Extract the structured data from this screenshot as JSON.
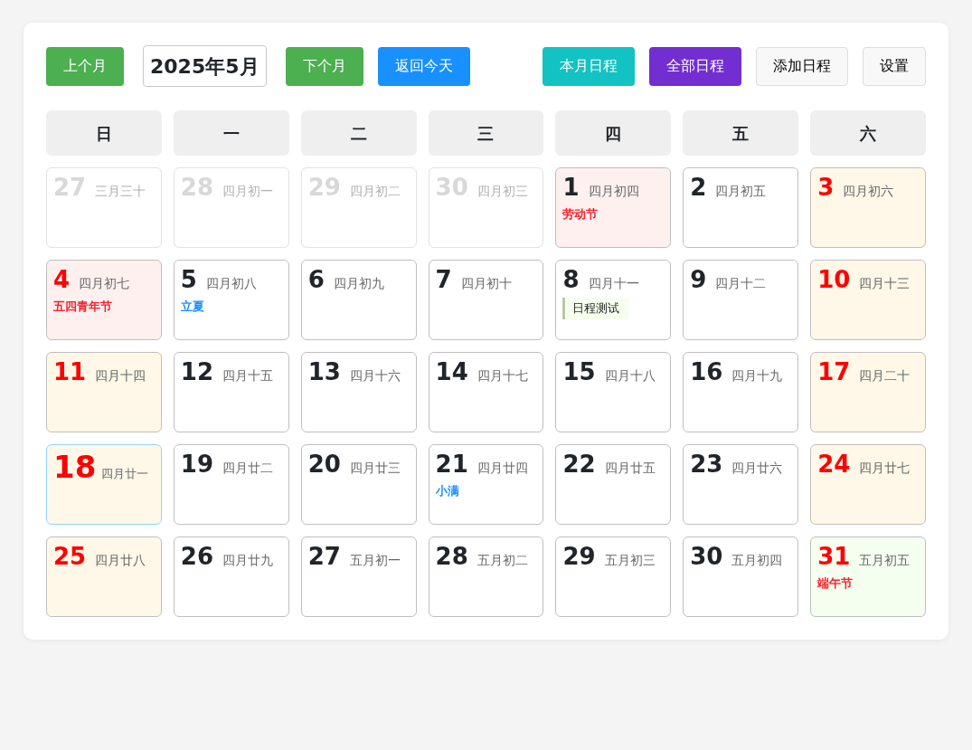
{
  "toolbar": {
    "left": [
      {
        "kind": "button",
        "label": "上个月",
        "color": "#4caf50"
      },
      {
        "kind": "title",
        "label": "2025年5月"
      },
      {
        "kind": "button",
        "label": "下个月",
        "color": "#4caf50"
      },
      {
        "kind": "button",
        "label": "返回今天",
        "color": "#1890ff"
      }
    ],
    "right": [
      {
        "kind": "button",
        "label": "本月日程",
        "color": "#13c2c2"
      },
      {
        "kind": "button",
        "label": "全部日程",
        "color": "#722ed1"
      },
      {
        "kind": "button",
        "label": "添加日程",
        "color": "#f8f8f8"
      },
      {
        "kind": "button",
        "label": "设置",
        "color": "#f8f8f8"
      }
    ]
  },
  "weekdays": [
    "日",
    "一",
    "二",
    "三",
    "四",
    "五",
    "六"
  ],
  "days": [
    {
      "day": "27",
      "lunar": "三月三十",
      "kind": "outside",
      "today": false
    },
    {
      "day": "28",
      "lunar": "四月初一",
      "kind": "outside",
      "today": false
    },
    {
      "day": "29",
      "lunar": "四月初二",
      "kind": "outside",
      "today": false
    },
    {
      "day": "30",
      "lunar": "四月初三",
      "kind": "outside",
      "today": false
    },
    {
      "day": "1",
      "lunar": "四月初四",
      "kind": "holiday",
      "weekend": false,
      "today": false,
      "note": {
        "text": "劳动节",
        "kind": "festival"
      }
    },
    {
      "day": "2",
      "lunar": "四月初五",
      "kind": "plain",
      "weekend": false,
      "today": false
    },
    {
      "day": "3",
      "lunar": "四月初六",
      "kind": "plain",
      "weekend": true,
      "today": false
    },
    {
      "day": "4",
      "lunar": "四月初七",
      "kind": "holiday",
      "weekend": true,
      "today": false,
      "note": {
        "text": "五四青年节",
        "kind": "festival"
      }
    },
    {
      "day": "5",
      "lunar": "四月初八",
      "kind": "plain",
      "weekend": false,
      "today": false,
      "note": {
        "text": "立夏",
        "kind": "term"
      }
    },
    {
      "day": "6",
      "lunar": "四月初九",
      "kind": "plain",
      "weekend": false,
      "today": false
    },
    {
      "day": "7",
      "lunar": "四月初十",
      "kind": "plain",
      "weekend": false,
      "today": false
    },
    {
      "day": "8",
      "lunar": "四月十一",
      "kind": "plain",
      "weekend": false,
      "today": false,
      "events": [
        "日程测试"
      ]
    },
    {
      "day": "9",
      "lunar": "四月十二",
      "kind": "plain",
      "weekend": false,
      "today": false
    },
    {
      "day": "10",
      "lunar": "四月十三",
      "kind": "plain",
      "weekend": true,
      "today": false
    },
    {
      "day": "11",
      "lunar": "四月十四",
      "kind": "plain",
      "weekend": true,
      "today": false
    },
    {
      "day": "12",
      "lunar": "四月十五",
      "kind": "plain",
      "weekend": false,
      "today": false
    },
    {
      "day": "13",
      "lunar": "四月十六",
      "kind": "plain",
      "weekend": false,
      "today": false
    },
    {
      "day": "14",
      "lunar": "四月十七",
      "kind": "plain",
      "weekend": false,
      "today": false
    },
    {
      "day": "15",
      "lunar": "四月十八",
      "kind": "plain",
      "weekend": false,
      "today": false
    },
    {
      "day": "16",
      "lunar": "四月十九",
      "kind": "plain",
      "weekend": false,
      "today": false
    },
    {
      "day": "17",
      "lunar": "四月二十",
      "kind": "plain",
      "weekend": true,
      "today": false
    },
    {
      "day": "18",
      "lunar": "四月廿一",
      "kind": "plain",
      "weekend": true,
      "today": true
    },
    {
      "day": "19",
      "lunar": "四月廿二",
      "kind": "plain",
      "weekend": false,
      "today": false
    },
    {
      "day": "20",
      "lunar": "四月廿三",
      "kind": "plain",
      "weekend": false,
      "today": false
    },
    {
      "day": "21",
      "lunar": "四月廿四",
      "kind": "plain",
      "weekend": false,
      "today": false,
      "note": {
        "text": "小满",
        "kind": "term"
      }
    },
    {
      "day": "22",
      "lunar": "四月廿五",
      "kind": "plain",
      "weekend": false,
      "today": false
    },
    {
      "day": "23",
      "lunar": "四月廿六",
      "kind": "plain",
      "weekend": false,
      "today": false
    },
    {
      "day": "24",
      "lunar": "四月廿七",
      "kind": "plain",
      "weekend": true,
      "today": false
    },
    {
      "day": "25",
      "lunar": "四月廿八",
      "kind": "plain",
      "weekend": true,
      "today": false
    },
    {
      "day": "26",
      "lunar": "四月廿九",
      "kind": "plain",
      "weekend": false,
      "today": false
    },
    {
      "day": "27",
      "lunar": "五月初一",
      "kind": "plain",
      "weekend": false,
      "today": false
    },
    {
      "day": "28",
      "lunar": "五月初二",
      "kind": "plain",
      "weekend": false,
      "today": false
    },
    {
      "day": "29",
      "lunar": "五月初三",
      "kind": "plain",
      "weekend": false,
      "today": false
    },
    {
      "day": "30",
      "lunar": "五月初四",
      "kind": "plain",
      "weekend": false,
      "today": false
    },
    {
      "day": "31",
      "lunar": "五月初五",
      "kind": "festival",
      "weekend": true,
      "today": false,
      "note": {
        "text": "端午节",
        "kind": "festival"
      }
    }
  ]
}
